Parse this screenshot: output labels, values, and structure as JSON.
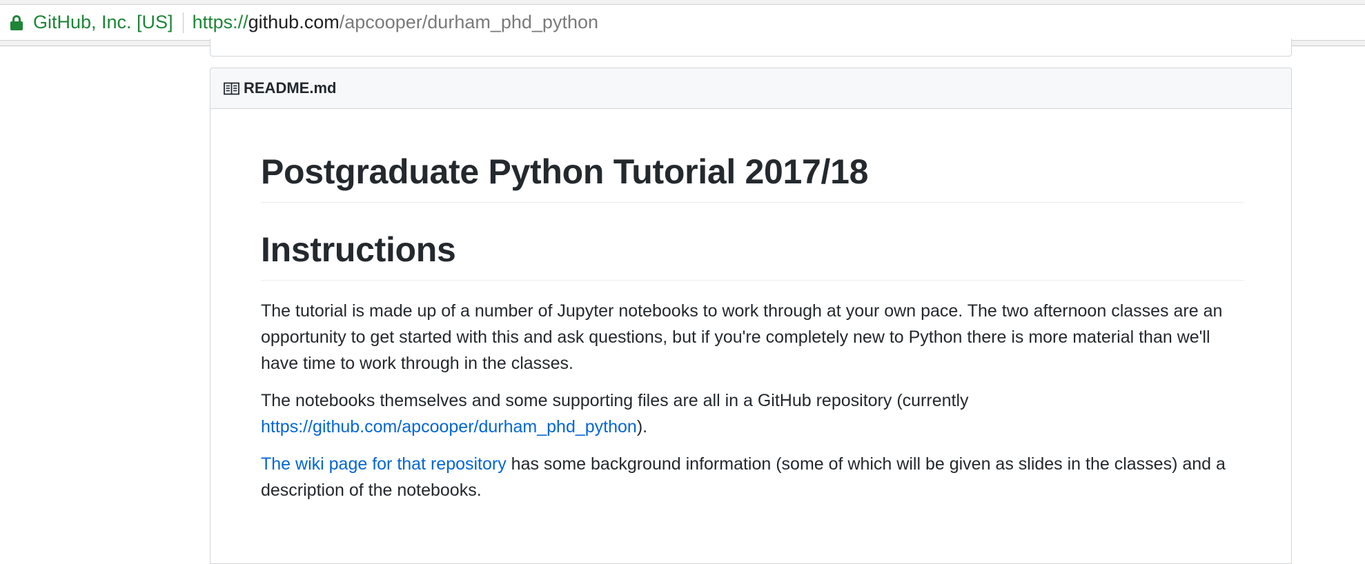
{
  "browser": {
    "security_label": "GitHub, Inc. [US]",
    "url_scheme": "https://",
    "url_host": "github.com",
    "url_path": "/apcooper/durham_phd_python",
    "secure_color": "#1e8537"
  },
  "readme": {
    "filename": "README.md",
    "icon": "book-icon"
  },
  "content": {
    "title": "Postgraduate Python Tutorial 2017/18",
    "section_heading": "Instructions",
    "para1": "The tutorial is made up of a number of Jupyter notebooks to work through at your own pace. The two afternoon classes are an opportunity to get started with this and ask questions, but if you're completely new to Python there is more material than we'll have time to work through in the classes.",
    "para2_prefix": "The notebooks themselves and some supporting files are all in a GitHub repository (currently ",
    "para2_link": "https://github.com/apcooper/durham_phd_python",
    "para2_suffix": ").",
    "para3_link": "The wiki page for that repository",
    "para3_suffix": " has some background information (some of which will be given as slides in the classes) and a description of the notebooks."
  },
  "colors": {
    "link": "#0366d6",
    "text": "#24292e",
    "border": "#d1d5da",
    "header_bg": "#f6f8fa"
  }
}
